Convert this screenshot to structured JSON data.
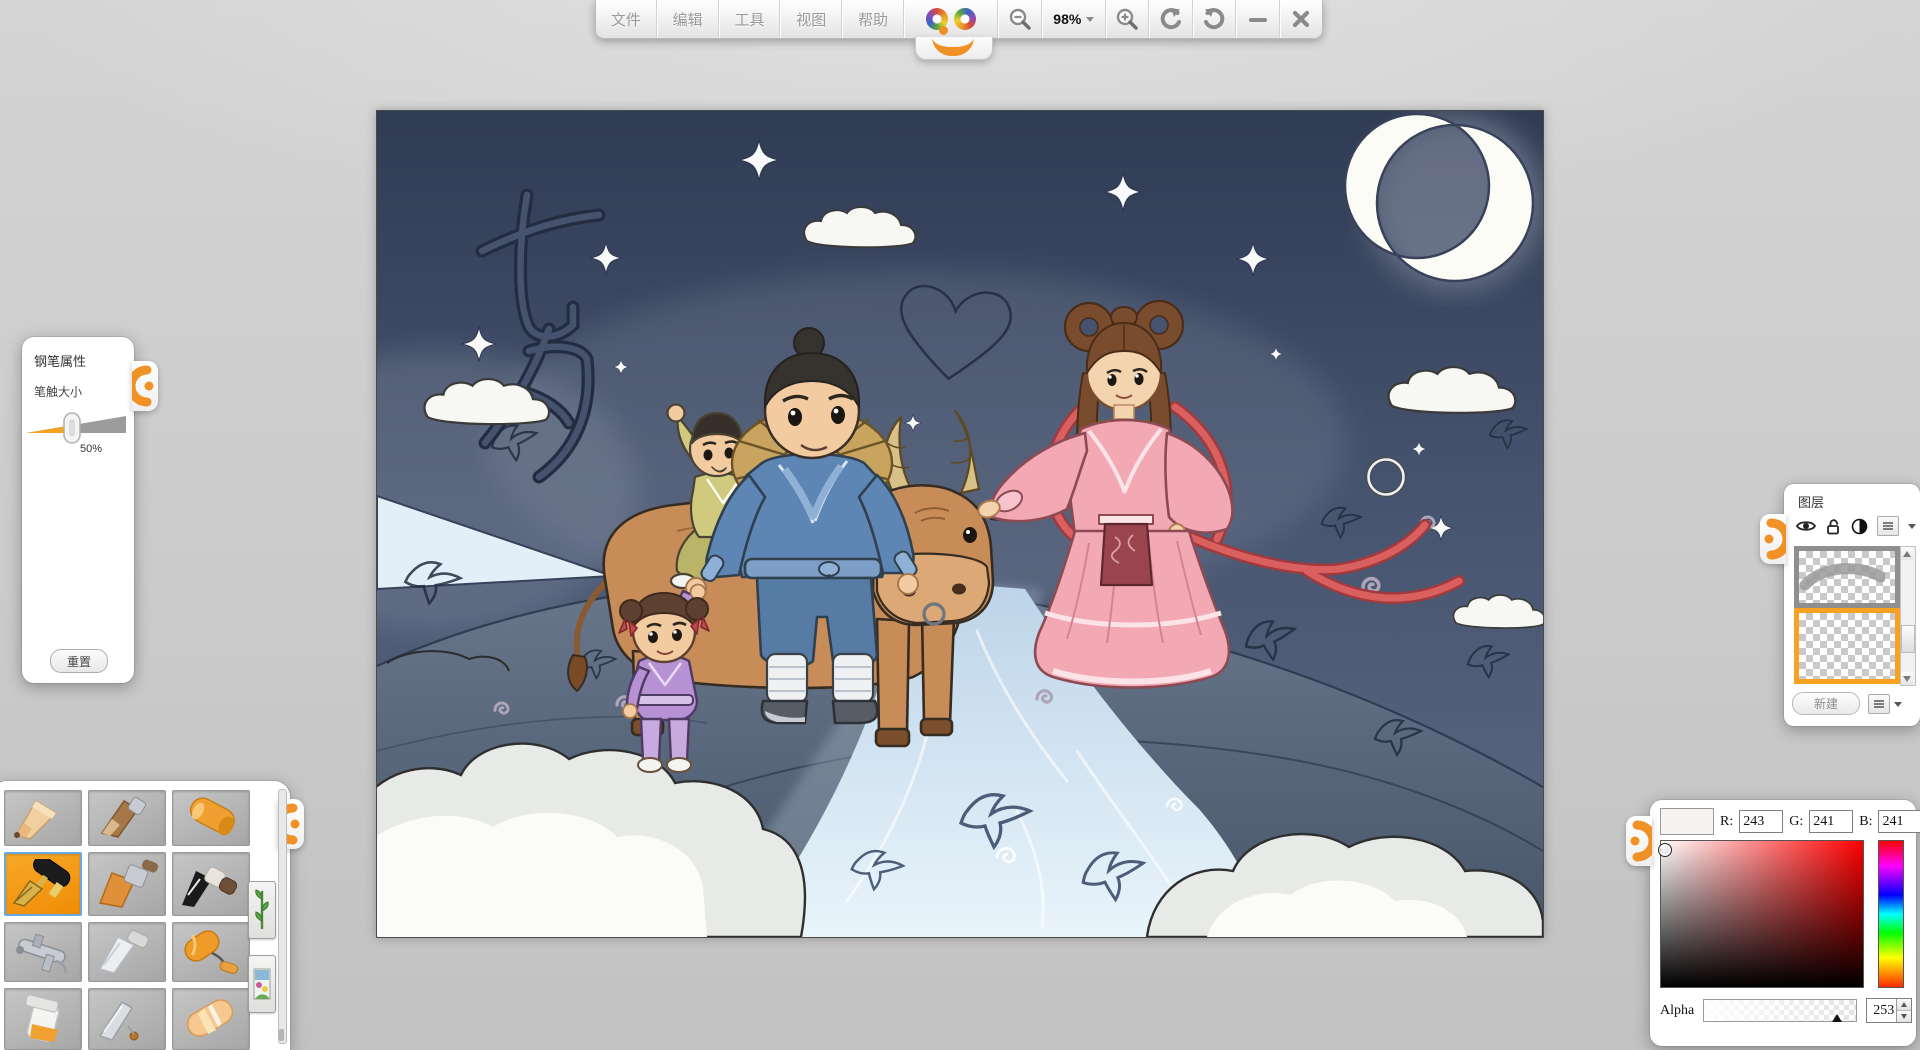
{
  "toolbar": {
    "menus": [
      "文件",
      "编辑",
      "工具",
      "视图",
      "帮助"
    ],
    "zoom_level": "98%",
    "icons": [
      "app-face-logo",
      "zoom-out-icon",
      "zoom-in-icon",
      "undo-icon",
      "redo-icon",
      "minimize-icon",
      "close-icon"
    ]
  },
  "pen_panel": {
    "title": "钢笔属性",
    "size_label": "笔触大小",
    "size_value": "50%",
    "size_percent": 50,
    "reset_label": "重置"
  },
  "tool_palette": {
    "selected_tool": "fountain-pen",
    "tools": [
      "pencil",
      "wood-pencil",
      "crayon",
      "fountain-pen",
      "flat-brush",
      "ink-brush",
      "airbrush",
      "palette-knife",
      "paint-roller",
      "paint-jar",
      "blade-knife",
      "eraser"
    ],
    "side_buttons": [
      "bamboo-stamp",
      "picture-stamp"
    ]
  },
  "layers_panel": {
    "title": "图层",
    "header_icons": [
      "eye-icon",
      "unlock-icon",
      "opacity-icon",
      "layer-menu-icon"
    ],
    "new_label": "新建",
    "layers": [
      {
        "name": "sketch-layer",
        "selected": false
      },
      {
        "name": "paint-layer",
        "selected": true
      }
    ]
  },
  "color_panel": {
    "swatch_color": "#f6f3f3",
    "r_label": "R:",
    "r": "243",
    "g_label": "G:",
    "g": "241",
    "b_label": "B:",
    "b": "241",
    "alpha_label": "Alpha",
    "alpha": "253",
    "accent_orange": "#f09126"
  },
  "canvas": {
    "sketch_text": "七夕"
  }
}
